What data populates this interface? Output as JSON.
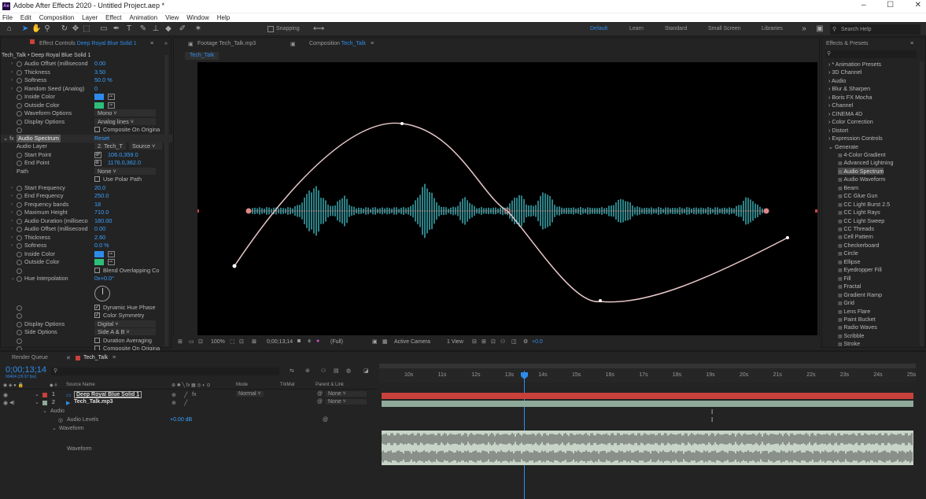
{
  "app": {
    "title": "Adobe After Effects 2020 - Untitled Project.aep *",
    "logo": "Ae"
  },
  "menu": [
    "File",
    "Edit",
    "Composition",
    "Layer",
    "Effect",
    "Animation",
    "View",
    "Window",
    "Help"
  ],
  "toolbar": {
    "snapping": "Snapping",
    "workspaces": [
      "Default",
      "Learn",
      "Standard",
      "Small Screen",
      "Libraries"
    ],
    "search_placeholder": "Search Help"
  },
  "effect_controls": {
    "tab_label": "Effect Controls",
    "tab_layer": "Deep Royal Blue Solid 1",
    "breadcrumb": "Tech_Talk • Deep Royal Blue Solid 1",
    "rows_top": [
      {
        "label": "Audio Offset (millisecond",
        "value": "0.00"
      },
      {
        "label": "Thickness",
        "value": "3.50"
      },
      {
        "label": "Softness",
        "value": "50.0 %"
      },
      {
        "label": "Random Seed (Analog)",
        "value": "0"
      }
    ],
    "inside_color_label": "Inside Color",
    "outside_color_label": "Outside Color",
    "waveform_options_label": "Waveform Options",
    "waveform_options_value": "Mono",
    "display_options_label": "Display Options",
    "display_options_value": "Analog lines",
    "composite_label": "Composite On Origina",
    "spectrum_title": "Audio Spectrum",
    "reset": "Reset",
    "audio_layer_label": "Audio Layer",
    "audio_layer_value": "2. Tech_T",
    "audio_layer_source": "Source",
    "start_point_label": "Start Point",
    "start_point_value": "106.0,359.0",
    "end_point_label": "End Point",
    "end_point_value": "1176.0,362.0",
    "path_label": "Path",
    "path_value": "None",
    "polar_label": "Use Polar Path",
    "rows_mid": [
      {
        "label": "Start Frequency",
        "value": "20.0"
      },
      {
        "label": "End Frequency",
        "value": "250.0"
      },
      {
        "label": "Frequency bands",
        "value": "18"
      },
      {
        "label": "Maximum Height",
        "value": "710.0"
      },
      {
        "label": "Audio Duration (milliseco",
        "value": "180.00"
      },
      {
        "label": "Audio Offset (millisecond",
        "value": "0.00"
      },
      {
        "label": "Thickness",
        "value": "2.60"
      },
      {
        "label": "Softness",
        "value": "0.0 %"
      }
    ],
    "blend_label": "Blend Overlapping Co",
    "hue_label": "Hue Interpolation",
    "hue_value": "0x+0.0°",
    "dynamic_hue": "Dynamic Hue Phase",
    "color_symmetry": "Color Symmetry",
    "display_options2_value": "Digital",
    "side_options_label": "Side Options",
    "side_options_value": "Side A & B",
    "duration_avg": "Duration Averaging",
    "composite2": "Composite On Origina"
  },
  "footage_tab": {
    "label": "Footage",
    "name": "Tech_Talk.mp3"
  },
  "comp_tab": {
    "label": "Composition",
    "name": "Tech_Talk",
    "crumb": "Tech_Talk"
  },
  "comp_bar": {
    "zoom": "100%",
    "timecode": "0;00;13;14",
    "resolution": "(Full)",
    "camera": "Active Camera",
    "views": "1 View",
    "exposure": "+0.0"
  },
  "effects_presets": {
    "title": "Effects & Presets",
    "search_placeholder": "",
    "categories": [
      "* Animation Presets",
      "3D Channel",
      "Audio",
      "Blur & Sharpen",
      "Boris FX Mocha",
      "Channel",
      "CINEMA 4D",
      "Color Correction",
      "Distort",
      "Expression Controls",
      "Generate"
    ],
    "generate_items": [
      "4-Color Gradient",
      "Advanced Lightning",
      "Audio Spectrum",
      "Audio Waveform",
      "Beam",
      "CC Glue Gun",
      "CC Light Burst 2.5",
      "CC Light Rays",
      "CC Light Sweep",
      "CC Threads",
      "Cell Pattern",
      "Checkerboard",
      "Circle",
      "Ellipse",
      "Eyedropper Fill",
      "Fill",
      "Fractal",
      "Gradient Ramp",
      "Grid",
      "Lens Flare",
      "Paint Bucket",
      "Radio Waves",
      "Scribble",
      "Stroke"
    ],
    "selected": "Audio Spectrum"
  },
  "timeline": {
    "render_queue": "Render Queue",
    "comp_tab": "Tech_Talk",
    "timecode": "0;00;13;14",
    "frame_info": "00404 (29.97 fps)",
    "search_placeholder": "",
    "columns": {
      "source": "Source Name",
      "mode": "Mode",
      "trkmat": "TrkMat",
      "parent": "Parent & Link"
    },
    "layers": [
      {
        "num": "1",
        "name": "Deep Royal Blue Solid 1",
        "mode": "Normal",
        "parent": "None",
        "color": "#c9413a"
      },
      {
        "num": "2",
        "name": "Tech_Talk.mp3",
        "mode": "",
        "parent": "None",
        "color": "#8fa99a"
      }
    ],
    "audio_label": "Audio",
    "audio_levels_label": "Audio Levels",
    "audio_levels_value": "+0.00 dB",
    "waveform_label": "Waveform",
    "waveform_sub": "Waveform",
    "ruler": [
      "10s",
      "11s",
      "12s",
      "13s",
      "14s",
      "15s",
      "16s",
      "17s",
      "18s",
      "19s",
      "20s",
      "21s",
      "22s",
      "23s",
      "24s",
      "25s"
    ]
  },
  "colors": {
    "accent": "#2d8ceb",
    "solid_bar": "#c9413a",
    "audio_bar": "#8fa99a",
    "waveform": "#3fb8c0",
    "path": "#e8c9c9"
  }
}
